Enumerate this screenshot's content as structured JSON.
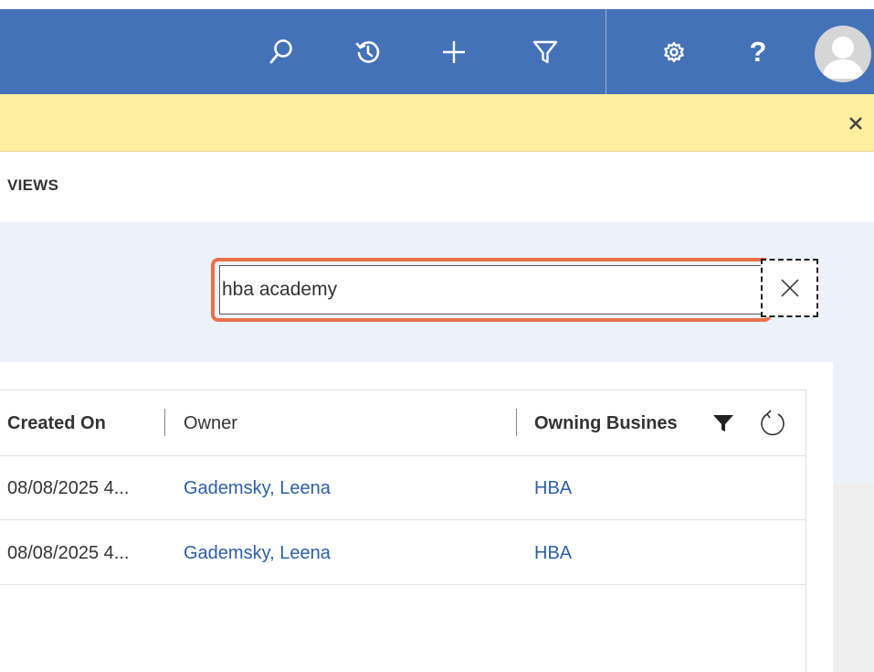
{
  "header": {
    "icons": [
      "search-icon",
      "recent-history-icon",
      "plus-icon",
      "filter-icon",
      "gear-icon",
      "help-icon",
      "avatar"
    ],
    "help_glyph": "?"
  },
  "notification": {
    "close_glyph": "✕"
  },
  "views": {
    "label": "VIEWS"
  },
  "search": {
    "value": "hba academy",
    "placeholder": ""
  },
  "grid": {
    "columns": [
      "Created On",
      "Owner",
      "Owning Busines"
    ],
    "rows": [
      {
        "created_on": "08/08/2025 4...",
        "owner": "Gademsky, Leena",
        "owning_business": "HBA"
      },
      {
        "created_on": "08/08/2025 4...",
        "owner": "Gademsky, Leena",
        "owning_business": "HBA"
      }
    ]
  },
  "colors": {
    "header_bg": "#4472b8",
    "notice_bg": "#fdeea0",
    "panel_bg": "#edf1f9",
    "link": "#2b5fa8",
    "highlight": "#e8704a"
  }
}
